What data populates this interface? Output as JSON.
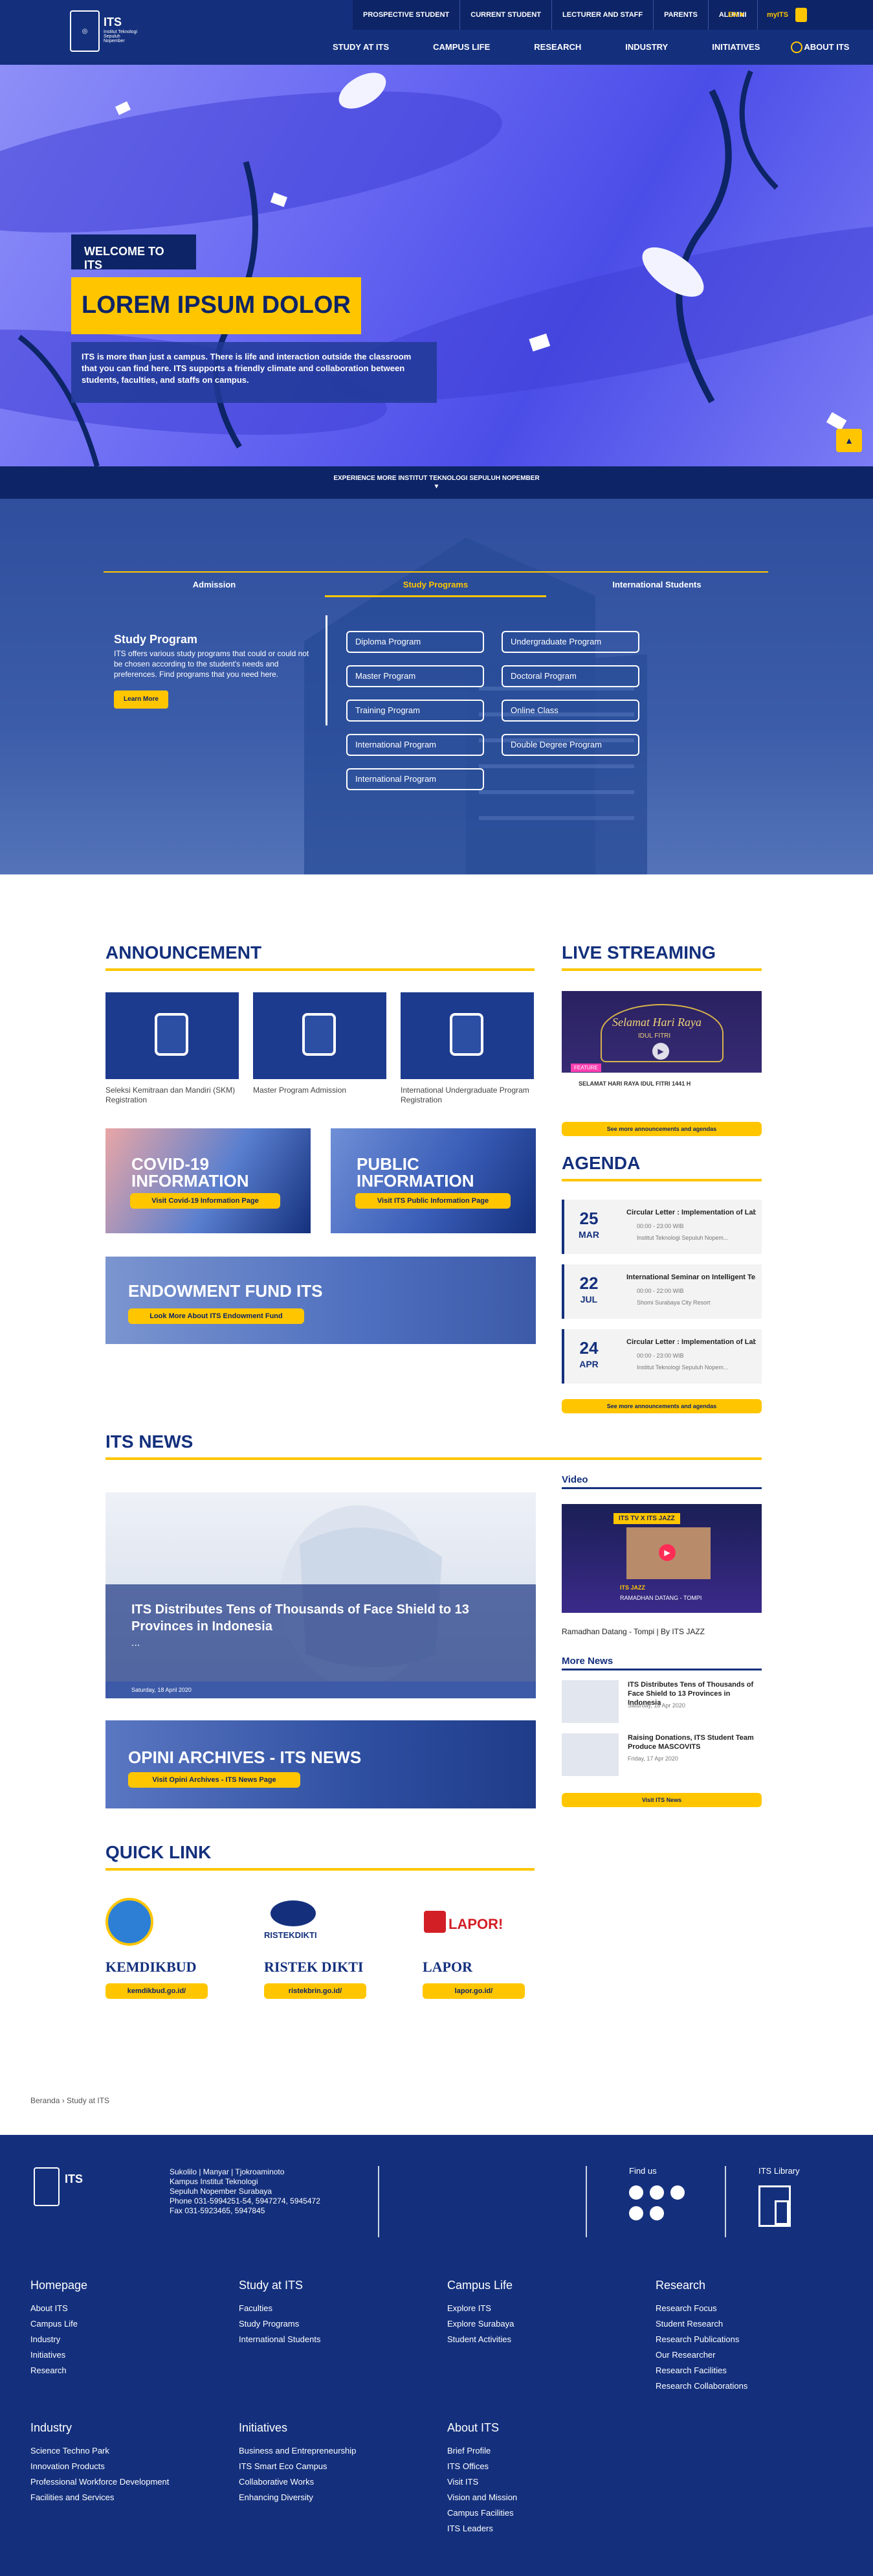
{
  "header": {
    "logo_text": "ITS",
    "logo_sub": "Institut Teknologi Sepuluh Nopember",
    "top_links": [
      "PROSPECTIVE STUDENT",
      "CURRENT STUDENT",
      "LECTURER AND STAFF",
      "PARENTS",
      "ALUMNI"
    ],
    "lang": "EN ▾",
    "myits": "myITS",
    "main_menu": [
      "STUDY AT ITS",
      "CAMPUS LIFE",
      "RESEARCH",
      "INDUSTRY",
      "INITIATIVES",
      "ABOUT ITS"
    ]
  },
  "hero": {
    "welcome": "WELCOME TO ITS",
    "title": "LOREM IPSUM DOLOR",
    "desc": "ITS is more than just a campus. There is life and interaction outside the classroom that you can find here. ITS supports a friendly climate and collaboration between students, faculties, and staffs on campus.",
    "band": "EXPERIENCE MORE INSTITUT TEKNOLOGI SEPULUH NOPEMBER"
  },
  "programs": {
    "tabs": [
      "Admission",
      "Study Programs",
      "International Students"
    ],
    "active_tab": 1,
    "heading": "Study Program",
    "text": "ITS offers various study programs that could or could not be chosen according to the student's needs and preferences. Find programs that you need here.",
    "learn_more": "Learn More",
    "buttons": [
      "Diploma Program",
      "Undergraduate Program",
      "Master Program",
      "Doctoral Program",
      "Training Program",
      "Online Class",
      "International Program",
      "Double Degree Program",
      "International Program"
    ]
  },
  "announcement": {
    "title": "ANNOUNCEMENT",
    "items": [
      "Seleksi Kemitraan dan Mandiri (SKM) Registration",
      "Master Program Admission",
      "International Undergraduate Program Registration"
    ],
    "covid": "COVID-19 INFORMATION",
    "covid_btn": "Visit Covid-19 Information Page",
    "public": "PUBLIC INFORMATION",
    "public_btn": "Visit ITS Public Information Page",
    "endow": "ENDOWMENT FUND ITS",
    "endow_btn": "Look More About ITS Endowment Fund"
  },
  "live": {
    "title": "LIVE STREAMING",
    "caption": "SELAMAT HARI RAYA IDUL FITRI 1441 H",
    "script_text": "Selamat Hari Raya",
    "sub_text": "IDUL FITRI",
    "badge": "FEATURE",
    "btn": "See more announcements and agendas"
  },
  "agenda": {
    "title": "AGENDA",
    "items": [
      {
        "day": "25",
        "mon": "MAR",
        "title": "Circular Letter : Implementation of Lab...",
        "time": "00:00 - 23:00 WIB",
        "place": "Institut Teknologi Sepuluh Nopem..."
      },
      {
        "day": "22",
        "mon": "JUL",
        "title": "International Seminar on Intelligent Te...",
        "time": "00:00 - 22:00 WIB",
        "place": "Shomi Surabaya City Resort"
      },
      {
        "day": "24",
        "mon": "APR",
        "title": "Circular Letter : Implementation of Lab...",
        "time": "00:00 - 23:00 WIB",
        "place": "Institut Teknologi Sepuluh Nopem..."
      }
    ],
    "btn": "See more announcements and agendas"
  },
  "news": {
    "title": "ITS NEWS",
    "headline": "ITS Distributes Tens of Thousands of Face Shield to 13 Provinces in Indonesia",
    "ellipsis": "...",
    "date": "Saturday, 18 April 2020",
    "opini": "OPINI ARCHIVES - ITS NEWS",
    "opini_btn": "Visit Opini Archives - ITS News Page",
    "video_title": "Video",
    "video_badge": "ITS TV X ITS JAZZ",
    "video_line1": "ITS JAZZ",
    "video_line2": "RAMADHAN DATANG - TOMPI",
    "video_caption": "Ramadhan Datang - Tompi | By ITS JAZZ",
    "more_title": "More News",
    "more": [
      {
        "t": "ITS Distributes Tens of Thousands of Face Shield to 13 Provinces in Indonesia",
        "d": "Saturday, 18 Apr 2020"
      },
      {
        "t": "Raising Donations, ITS Student Team Produce MASCOVITS",
        "d": "Friday, 17 Apr 2020"
      }
    ],
    "more_btn": "Visit ITS News"
  },
  "quick": {
    "title": "QUICK LINK",
    "items": [
      {
        "name": "KEMDIKBUD",
        "url": "kemdikbud.go.id/"
      },
      {
        "name": "RISTEK DIKTI",
        "url": "ristekbrin.go.id/"
      },
      {
        "name": "LAPOR",
        "url": "lapor.go.id/"
      }
    ],
    "lapor_logo": "LAPOR!",
    "ristek_logo": "RISTEKDIKTI"
  },
  "breadcrumb": "Beranda  ›  Study at ITS",
  "footer": {
    "logo": "ITS",
    "address": [
      "Sukolilo | Manyar | Tjokroaminoto",
      "Kampus Institut Teknologi",
      "Sepuluh Nopember Surabaya",
      "Phone 031-5994251-54, 5947274, 5945472",
      "Fax 031-5923465, 5947845"
    ],
    "find_us": "Find us",
    "library": "ITS Library",
    "cols": [
      {
        "h": "Homepage",
        "items": [
          "About ITS",
          "Campus Life",
          "Industry",
          "Initiatives",
          "Research"
        ]
      },
      {
        "h": "Study at ITS",
        "items": [
          "Faculties",
          "Study Programs",
          "International Students"
        ]
      },
      {
        "h": "Campus Life",
        "items": [
          "Explore ITS",
          "Explore Surabaya",
          "Student Activities"
        ]
      },
      {
        "h": "Research",
        "items": [
          "Research Focus",
          "Student Research",
          "Research Publications",
          "Our Researcher",
          "Research Facilities",
          "Research Collaborations"
        ]
      },
      {
        "h": "Industry",
        "items": [
          "Science Techno Park",
          "Innovation Products",
          "Professional Workforce Development",
          "Facilities and Services"
        ]
      },
      {
        "h": "Initiatives",
        "items": [
          "Business and Entrepreneurship",
          "ITS Smart Eco Campus",
          "Collaborative Works",
          "Enhancing Diversity"
        ]
      },
      {
        "h": "About ITS",
        "items": [
          "Brief Profile",
          "ITS Offices",
          "Visit ITS",
          "Vision and Mission",
          "Campus Facilities",
          "ITS Leaders"
        ]
      }
    ]
  }
}
